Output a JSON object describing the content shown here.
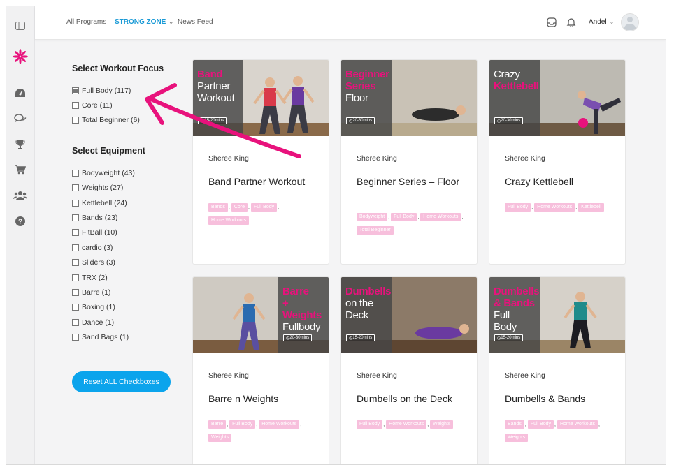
{
  "brand": {
    "accent": "#e8127c",
    "link": "#1a9ad6",
    "button": "#0ba4ec"
  },
  "sidebar": {
    "items": [
      {
        "icon": "panel-toggle-icon"
      },
      {
        "icon": "flower-logo-icon"
      },
      {
        "icon": "dashboard-gauge-icon"
      },
      {
        "icon": "chat-icon"
      },
      {
        "icon": "trophy-icon"
      },
      {
        "icon": "cart-icon"
      },
      {
        "icon": "users-icon"
      },
      {
        "icon": "help-icon"
      }
    ]
  },
  "topbar": {
    "all_programs": "All Programs",
    "strong_zone": "STRONG ZONE",
    "news_feed": "News Feed",
    "user_name": "Andel"
  },
  "filters": {
    "focus_title": "Select Workout Focus",
    "focus": [
      {
        "label": "Full Body (117)",
        "checked": true
      },
      {
        "label": "Core (11)",
        "checked": false
      },
      {
        "label": "Total Beginner (6)",
        "checked": false
      }
    ],
    "equipment_title": "Select Equipment",
    "equipment": [
      {
        "label": "Bodyweight (43)"
      },
      {
        "label": "Weights (27)"
      },
      {
        "label": "Kettlebell (24)"
      },
      {
        "label": "Bands (23)"
      },
      {
        "label": "FitBall (10)"
      },
      {
        "label": "cardio (3)"
      },
      {
        "label": "Sliders (3)"
      },
      {
        "label": "TRX (2)"
      },
      {
        "label": "Barre (1)"
      },
      {
        "label": "Boxing (1)"
      },
      {
        "label": "Dance (1)"
      },
      {
        "label": "Sand Bags (1)"
      }
    ],
    "reset_label": "Reset ALL Checkboxes"
  },
  "cards": [
    {
      "thumb_pink": [
        "Band"
      ],
      "thumb_white": [
        "Partner",
        "Workout"
      ],
      "duration": "15-20mins",
      "author": "Sheree King",
      "title": "Band Partner Workout",
      "tags": [
        "Bands",
        "Core",
        "Full Body",
        "Home Workouts"
      ]
    },
    {
      "thumb_pink": [
        "Beginner",
        "Series"
      ],
      "thumb_white": [
        "Floor"
      ],
      "duration": "20-30mins",
      "author": "Sheree King",
      "title": "Beginner Series – Floor",
      "tags": [
        "Bodyweight",
        "Full Body",
        "Home Workouts",
        "Total Beginner"
      ]
    },
    {
      "thumb_pink": [
        "Kettlebell"
      ],
      "thumb_white": [
        "Crazy"
      ],
      "duration": "20-30mins",
      "author": "Sheree King",
      "title": "Crazy Kettlebell",
      "tags": [
        "Full Body",
        "Home Workouts",
        "Kettlebell"
      ]
    },
    {
      "thumb_pink": [
        "Barre",
        "+",
        "Weights"
      ],
      "thumb_white": [
        "Fullbody"
      ],
      "duration": "20-30mins",
      "author": "Sheree King",
      "title": "Barre n Weights",
      "tags": [
        "Barre",
        "Full Body",
        "Home Workouts",
        "Weights"
      ]
    },
    {
      "thumb_pink": [
        "Dumbells"
      ],
      "thumb_white": [
        "on the",
        "Deck"
      ],
      "duration": "15-20mins",
      "author": "Sheree King",
      "title": "Dumbells on the Deck",
      "tags": [
        "Full Body",
        "Home Workouts",
        "Weights"
      ]
    },
    {
      "thumb_pink": [
        "Dumbells",
        "& Bands"
      ],
      "thumb_white": [
        "Full",
        "Body"
      ],
      "duration": "15-20mins",
      "author": "Sheree King",
      "title": "Dumbells & Bands",
      "tags": [
        "Bands",
        "Full Body",
        "Home Workouts",
        "Weights"
      ]
    }
  ]
}
